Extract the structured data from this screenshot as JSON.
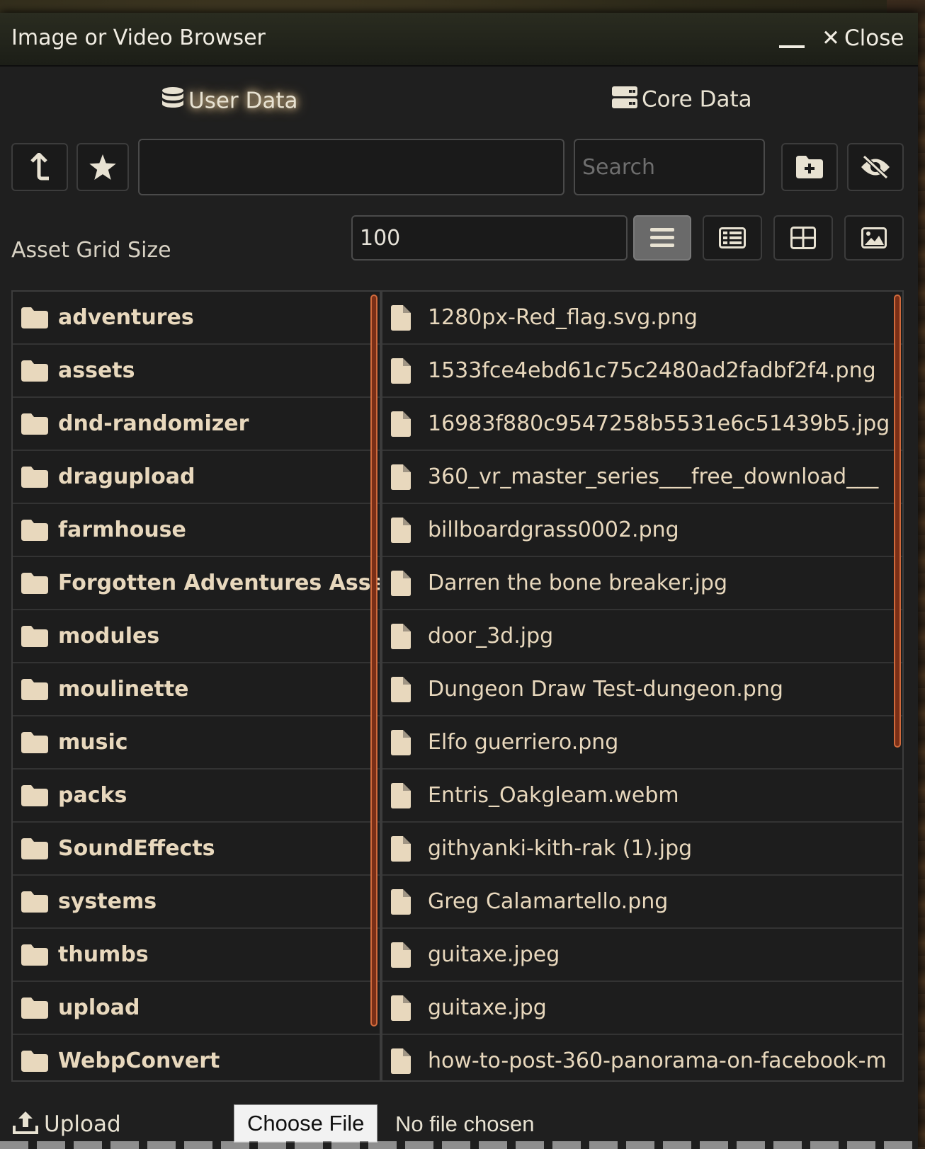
{
  "window": {
    "title": "Image or Video Browser",
    "close_label": "Close"
  },
  "tabs": [
    {
      "label": "User Data",
      "active": true
    },
    {
      "label": "Core Data",
      "active": false
    }
  ],
  "toolbar": {
    "path_value": "",
    "search_placeholder": "Search"
  },
  "grid": {
    "label": "Asset Grid Size",
    "value": "100"
  },
  "directories": [
    "adventures",
    "assets",
    "dnd-randomizer",
    "dragupload",
    "farmhouse",
    "Forgotten Adventures Assets",
    "modules",
    "moulinette",
    "music",
    "packs",
    "SoundEffects",
    "systems",
    "thumbs",
    "upload",
    "WebpConvert"
  ],
  "files": [
    "1280px-Red_flag.svg.png",
    "1533fce4ebd61c75c2480ad2fadbf2f4.png",
    "16983f880c9547258b5531e6c51439b5.jpg",
    "360_vr_master_series___free_download___",
    "billboardgrass0002.png",
    "Darren the bone breaker.jpg",
    "door_3d.jpg",
    "Dungeon Draw Test-dungeon.png",
    "Elfo guerriero.png",
    "Entris_Oakgleam.webm",
    "githyanki-kith-rak (1).jpg",
    "Greg Calamartello.png",
    "guitaxe.jpeg",
    "guitaxe.jpg",
    "how-to-post-360-panorama-on-facebook-m"
  ],
  "footer": {
    "upload_label": "Upload",
    "choose_label": "Choose File",
    "no_file": "No file chosen"
  },
  "colors": {
    "accent_scroll": "#d06a3c",
    "text_warm": "#e8d8bd",
    "active_view": "#6a6a6a"
  }
}
